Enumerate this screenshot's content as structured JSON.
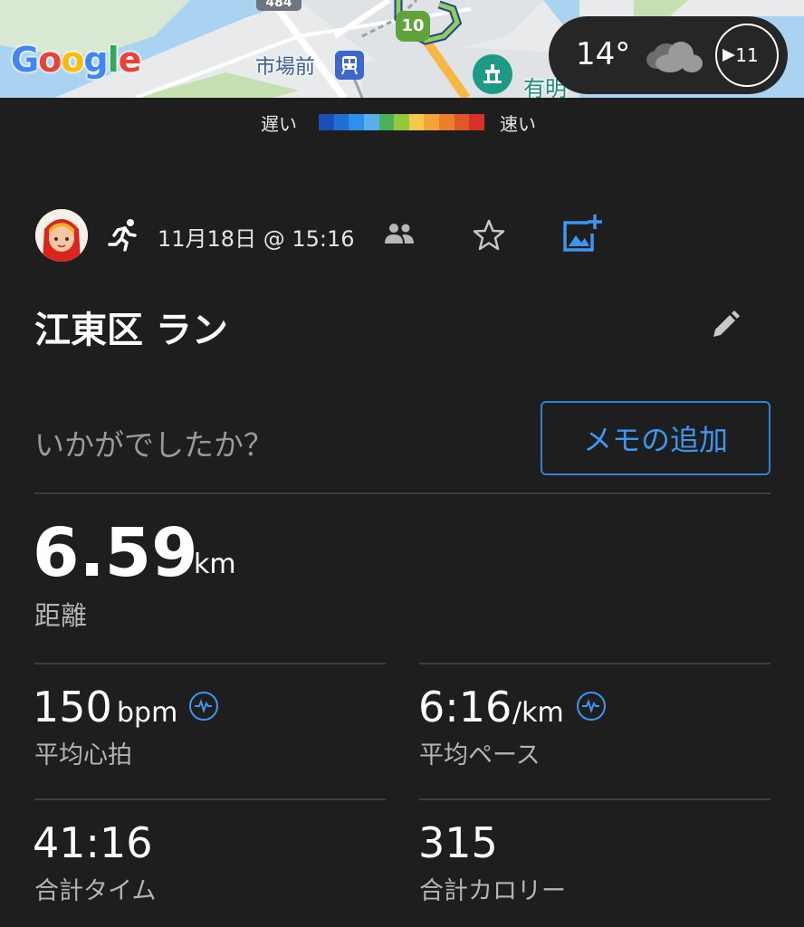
{
  "map": {
    "station_label": "市場前",
    "ariake_label": "有明",
    "road_number": "484",
    "km_marker": "10",
    "google_logo": [
      "G",
      "o",
      "o",
      "g",
      "l",
      "e"
    ]
  },
  "weather": {
    "temperature": "14°",
    "condition_icon": "cloud-icon",
    "wind_speed": "11"
  },
  "speed_legend": {
    "slow_label": "遅い",
    "fast_label": "速い",
    "colors": [
      "#1a4fb8",
      "#1f6fd6",
      "#2f8ff0",
      "#5aaeea",
      "#4cb05a",
      "#95c83a",
      "#f5c84a",
      "#f2a43a",
      "#ee7f2a",
      "#e0582a",
      "#d8302a"
    ]
  },
  "activity": {
    "date": "11月18日 @ 15:16",
    "title": "江東区 ラン",
    "prompt": "いかがでしたか？",
    "memo_button": "メモの追加"
  },
  "stats": {
    "distance": {
      "value": "6.59",
      "unit": "km",
      "label": "距離"
    },
    "avg_hr": {
      "value": "150",
      "unit": "bpm",
      "label": "平均心拍"
    },
    "avg_pace": {
      "value": "6:16",
      "unit": "/km",
      "label": "平均ペース"
    },
    "total_time": {
      "value": "41:16",
      "label": "合計タイム"
    },
    "calories": {
      "value": "315",
      "label": "合計カロリー"
    }
  }
}
